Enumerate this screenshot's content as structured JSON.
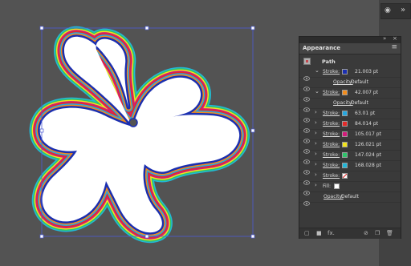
{
  "panel": {
    "title": "Appearance",
    "close_glyph": "×",
    "collapse_glyph": "»",
    "menu_glyph": "≡",
    "object_label": "Path"
  },
  "attributes": [
    {
      "kind": "stroke",
      "label": "Stroke:",
      "color": "#1b2fb0",
      "value": "21.003 pt",
      "expanded": true
    },
    {
      "kind": "opacity",
      "label": "Opacity:",
      "value": "Default"
    },
    {
      "kind": "stroke",
      "label": "Stroke:",
      "color": "#f28c1c",
      "value": "42.007 pt",
      "expanded": true
    },
    {
      "kind": "opacity",
      "label": "Opacity:",
      "value": "Default"
    },
    {
      "kind": "stroke",
      "label": "Stroke:",
      "color": "#25a7e0",
      "value": "63.01 pt"
    },
    {
      "kind": "stroke",
      "label": "Stroke:",
      "color": "#e32a2a",
      "value": "84.014 pt"
    },
    {
      "kind": "stroke",
      "label": "Stroke:",
      "color": "#d21a7a",
      "value": "105.017 pt"
    },
    {
      "kind": "stroke",
      "label": "Stroke:",
      "color": "#f2e41c",
      "value": "126.021 pt"
    },
    {
      "kind": "stroke",
      "label": "Stroke:",
      "color": "#2fc36b",
      "value": "147.024 pt"
    },
    {
      "kind": "stroke",
      "label": "Stroke:",
      "color": "#22b7d8",
      "value": "168.028 pt"
    },
    {
      "kind": "stroke",
      "label": "Stroke:",
      "color": "none",
      "value": ""
    },
    {
      "kind": "fill",
      "label": "Fill:",
      "color": "#ffffff",
      "value": ""
    },
    {
      "kind": "opacity",
      "label": "Opacity:",
      "value": "Default"
    }
  ],
  "footer_icons": [
    "add-stroke-icon",
    "add-fill-icon",
    "fx-icon",
    "clear-appearance-icon",
    "duplicate-item-icon",
    "delete-item-icon"
  ],
  "footer_glyphs": {
    "fx": "fx."
  },
  "dock": {
    "eye_glyph": "◉",
    "chevron_glyph": "»"
  },
  "artwork": {
    "shape": "butterfly",
    "fill": "#ffffff",
    "outline_colors": [
      "#22b7d8",
      "#2fc36b",
      "#f2e41c",
      "#d21a7a",
      "#e32a2a",
      "#25a7e0",
      "#f28c1c",
      "#1b2fb0"
    ],
    "selection_color": "#4b5bd6"
  }
}
